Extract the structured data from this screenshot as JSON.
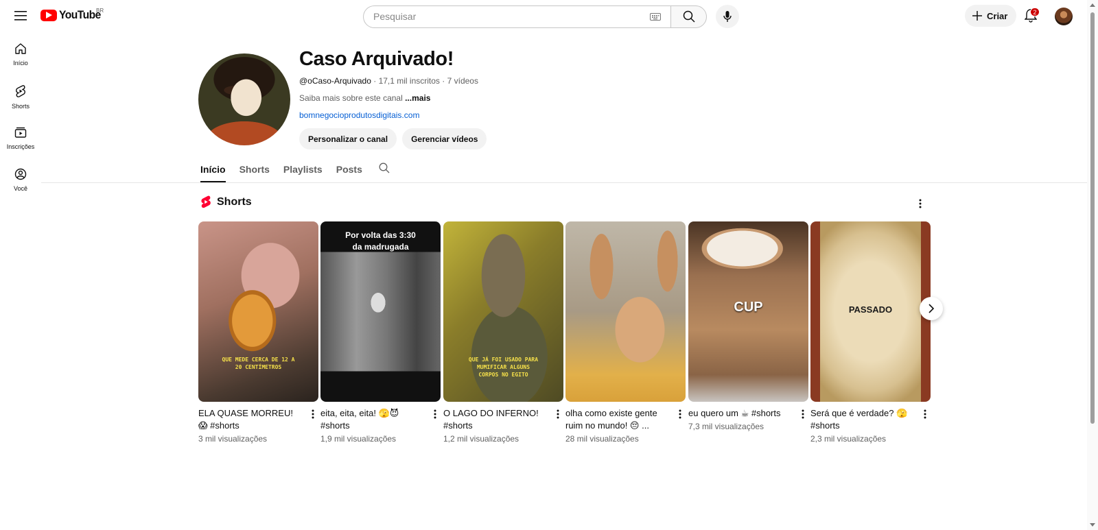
{
  "topbar": {
    "logo_text": "YouTube",
    "country_code": "BR",
    "search_placeholder": "Pesquisar",
    "create_label": "Criar",
    "notification_count": "2"
  },
  "leftnav": {
    "items": [
      {
        "label": "Início",
        "icon": "home-icon"
      },
      {
        "label": "Shorts",
        "icon": "shorts-icon"
      },
      {
        "label": "Inscrições",
        "icon": "subscriptions-icon"
      },
      {
        "label": "Você",
        "icon": "you-icon"
      }
    ]
  },
  "channel": {
    "title": "Caso Arquivado!",
    "handle": "@oCaso-Arquivado",
    "stats": " · 17,1 mil inscritos · 7 vídeos",
    "description": "Saiba mais sobre este canal ",
    "more_label": "...mais",
    "link": "bomnegocioprodutosdigitais.com",
    "customize_label": "Personalizar o canal",
    "manage_label": "Gerenciar vídeos"
  },
  "tabs": [
    "Início",
    "Shorts",
    "Playlists",
    "Posts"
  ],
  "shorts_section": {
    "title": "Shorts",
    "items": [
      {
        "title": "ELA QUASE MORREU! 😱 #shorts",
        "views": "3 mil visualizações",
        "overlay": "QUE MEDE CERCA DE 12 A 20 CENTÍMETROS"
      },
      {
        "title": "eita, eita, eita! 🫣😈 #shorts",
        "views": "1,9 mil visualizações",
        "overlay": "Por volta das 3:30 da madrugada"
      },
      {
        "title": "O LAGO DO INFERNO! #shorts",
        "views": "1,2 mil visualizações",
        "overlay": "QUE JÁ FOI USADO PARA MUMIFICAR ALGUNS CORPOS NO EGITO"
      },
      {
        "title": "olha como existe gente ruim no mundo! 😔 ...",
        "views": "28 mil visualizações",
        "overlay": ""
      },
      {
        "title": "eu quero um ☕ #shorts",
        "views": "7,3 mil visualizações",
        "overlay": "CUP"
      },
      {
        "title": "Será que é verdade? 🫣 #shorts",
        "views": "2,3 mil visualizações",
        "overlay": "PASSADO"
      }
    ]
  },
  "colors": {
    "brand_red": "#ff0000",
    "link_blue": "#065fd4",
    "badge_red": "#cc0000"
  }
}
